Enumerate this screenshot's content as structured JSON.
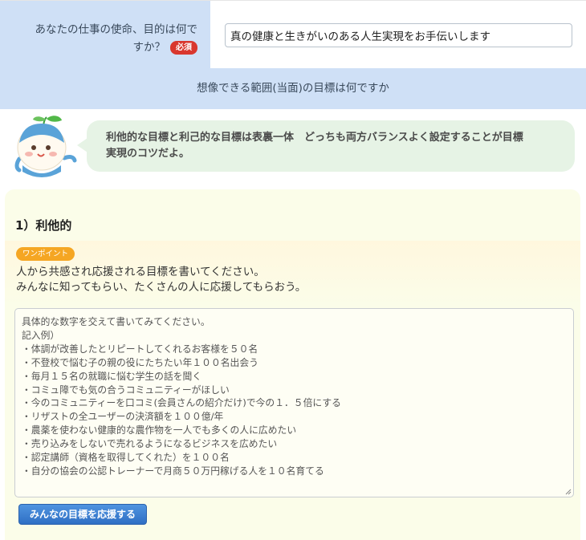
{
  "mission": {
    "label_line1": "あなたの仕事の使命、目的は何で",
    "label_line2": "すか？",
    "required_badge": "必須",
    "value": "真の健康と生きがいのある人生実現をお手伝いします"
  },
  "section": {
    "title": "想像できる範囲(当面)の目標は何ですか"
  },
  "hint": {
    "mascot_icon": "sprout-mascot-icon",
    "line1": "利他的な目標と利己的な目標は表裏一体　どっちも両方バランスよく設定することが目標",
    "line2": "実現のコツだよ。"
  },
  "altruistic": {
    "heading": "1）利他的",
    "tip_badge": "ワンポイント",
    "tip_line1": "人から共感され応援される目標を書いてください。",
    "tip_line2": "みんなに知ってもらい、たくさんの人に応援してもらおう。",
    "placeholder_lines": [
      "具体的な数字を交えて書いてみてください。",
      "記入例）",
      "・体調が改善したとリピートしてくれるお客様を５０名",
      "・不登校で悩む子の親の役にたちたい年１００名出会う",
      "・毎月１５名の就職に悩む学生の話を聞く",
      "・コミュ障でも気の合うコミュニティーがほしい",
      "・今のコミュニティーを口コミ(会員さんの紹介だけ)で今の１．５倍にする",
      "・リザストの全ユーザーの決済額を１００億/年",
      "・農薬を使わない健康的な農作物を一人でも多くの人に広めたい",
      "・売り込みをしないで売れるようになるビジネスを広めたい",
      "・認定講師（資格を取得してくれた）を１００名",
      "・自分の協会の公認トレーナーで月商５０万円稼げる人を１０名育てる"
    ],
    "support_button": "みんなの目標を応援する"
  },
  "colors": {
    "label_bg": "#cfe0f6",
    "required_red": "#d9372e",
    "bubble_green": "#e6f3e5",
    "card_bg": "#fbfde9",
    "onepoint_orange": "#f5a623",
    "button_blue": "#2f6fc4"
  }
}
